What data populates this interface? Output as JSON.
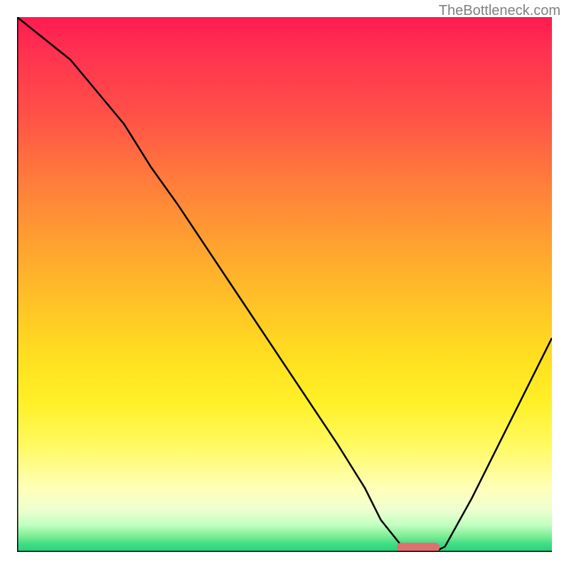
{
  "watermark": "TheBottleneck.com",
  "chart_data": {
    "type": "line",
    "title": "",
    "xlabel": "",
    "ylabel": "",
    "xlim": [
      0,
      100
    ],
    "ylim": [
      0,
      100
    ],
    "x": [
      0,
      10,
      20,
      25,
      30,
      40,
      50,
      60,
      65,
      68,
      72,
      75,
      78,
      80,
      85,
      90,
      95,
      100
    ],
    "values": [
      100,
      92,
      80,
      72,
      65,
      50,
      35,
      20,
      12,
      6,
      1,
      0,
      0,
      1,
      10,
      20,
      30,
      40
    ],
    "marker": {
      "x_start": 71,
      "x_end": 79,
      "y": 0
    },
    "gradient_stops": [
      {
        "pos": 0,
        "color": "#ff1a50"
      },
      {
        "pos": 0.5,
        "color": "#ffc426"
      },
      {
        "pos": 0.85,
        "color": "#ffffb8"
      },
      {
        "pos": 1.0,
        "color": "#20d47a"
      }
    ]
  }
}
